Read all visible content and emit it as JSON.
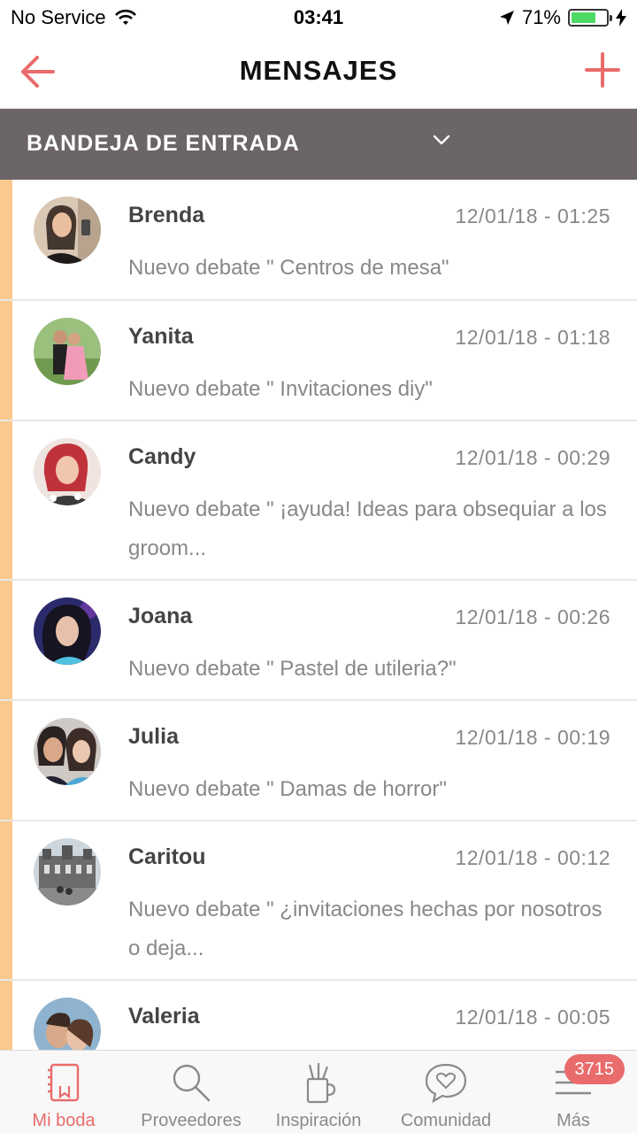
{
  "status_bar": {
    "carrier": "No Service",
    "time": "03:41",
    "battery_percent": "71%",
    "battery_level": 0.71
  },
  "nav": {
    "title": "MENSAJES"
  },
  "inbox": {
    "label": "BANDEJA DE ENTRADA"
  },
  "messages": [
    {
      "name": "Brenda",
      "date": "12/01/18 - 01:25",
      "preview": "Nuevo debate \" Centros de mesa\""
    },
    {
      "name": "Yanita",
      "date": "12/01/18 - 01:18",
      "preview": "Nuevo debate \" Invitaciones diy\""
    },
    {
      "name": "Candy",
      "date": "12/01/18 - 00:29",
      "preview": "Nuevo debate \" ¡ayuda! Ideas para obsequiar a los groom..."
    },
    {
      "name": "Joana",
      "date": "12/01/18 - 00:26",
      "preview": "Nuevo debate \" Pastel de utileria?\""
    },
    {
      "name": "Julia",
      "date": "12/01/18 - 00:19",
      "preview": "Nuevo debate \" Damas de horror\""
    },
    {
      "name": "Caritou",
      "date": "12/01/18 - 00:12",
      "preview": "Nuevo debate \" ¿invitaciones hechas por nosotros o deja..."
    },
    {
      "name": "Valeria",
      "date": "12/01/18 - 00:05",
      "preview": ""
    }
  ],
  "tabs": [
    {
      "label": "Mi boda",
      "icon": "notebook-icon",
      "active": true
    },
    {
      "label": "Proveedores",
      "icon": "search-icon"
    },
    {
      "label": "Inspiración",
      "icon": "pencil-cup-icon"
    },
    {
      "label": "Comunidad",
      "icon": "chat-heart-icon"
    },
    {
      "label": "Más",
      "icon": "menu-icon",
      "badge": "3715"
    }
  ],
  "colors": {
    "accent": "#e96b6b",
    "inbox_bar": "#6b6469",
    "unread_marker": "#f9c98e"
  }
}
